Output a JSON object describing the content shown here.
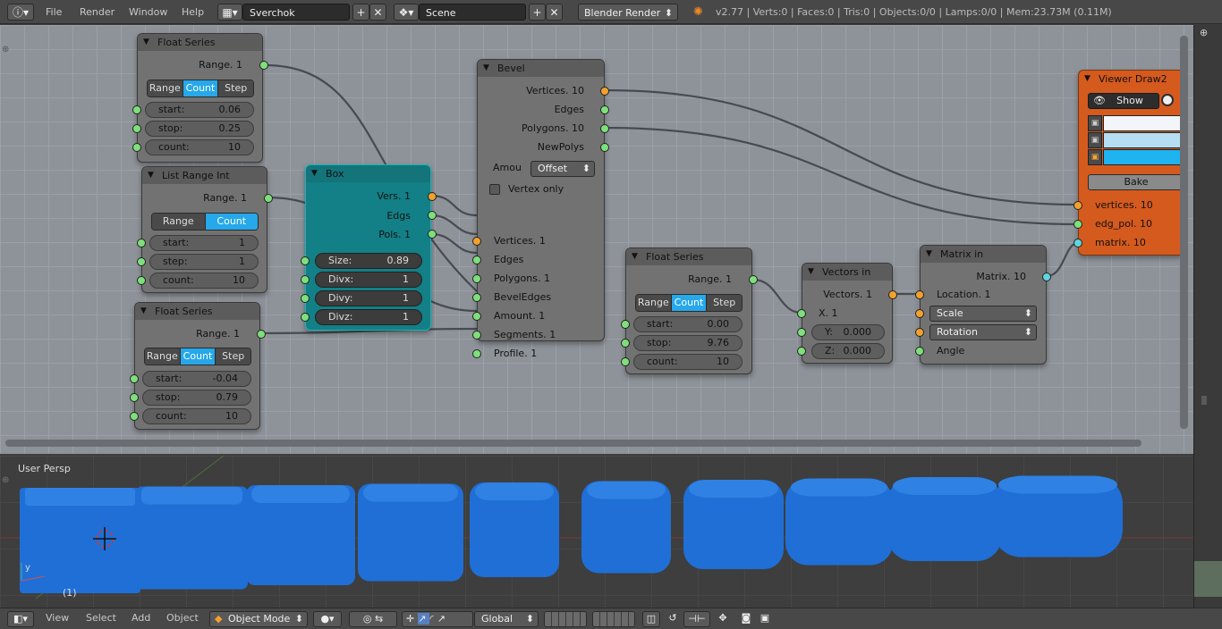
{
  "top": {
    "menus": [
      "File",
      "Render",
      "Window",
      "Help"
    ],
    "screen_layout": "Sverchok",
    "scene": "Scene",
    "render_engine": "Blender Render",
    "stats": "v2.77 | Verts:0 | Faces:0 | Tris:0 | Objects:0/0 | Lamps:0/0 | Mem:23.73M (0.11M)"
  },
  "nodes": {
    "float1": {
      "title": "Float Series",
      "out": "Range. 1",
      "modes": [
        "Range",
        "Count",
        "Step"
      ],
      "active_mode": "Count",
      "fields": [
        {
          "k": "start:",
          "v": "0.06"
        },
        {
          "k": "stop:",
          "v": "0.25"
        },
        {
          "k": "count:",
          "v": "10"
        }
      ]
    },
    "listrange": {
      "title": "List Range Int",
      "out": "Range. 1",
      "modes": [
        "Range",
        "Count"
      ],
      "active_mode": "Count",
      "fields": [
        {
          "k": "start:",
          "v": "1"
        },
        {
          "k": "step:",
          "v": "1"
        },
        {
          "k": "count:",
          "v": "10"
        }
      ]
    },
    "float2": {
      "title": "Float Series",
      "out": "Range. 1",
      "modes": [
        "Range",
        "Count",
        "Step"
      ],
      "active_mode": "Count",
      "fields": [
        {
          "k": "start:",
          "v": "-0.04"
        },
        {
          "k": "stop:",
          "v": "0.79"
        },
        {
          "k": "count:",
          "v": "10"
        }
      ]
    },
    "box": {
      "title": "Box",
      "outs": [
        "Vers. 1",
        "Edgs",
        "Pols. 1"
      ],
      "fields": [
        {
          "k": "Size:",
          "v": "0.89"
        },
        {
          "k": "Divx:",
          "v": "1"
        },
        {
          "k": "Divy:",
          "v": "1"
        },
        {
          "k": "Divz:",
          "v": "1"
        }
      ]
    },
    "bevel": {
      "title": "Bevel",
      "outs": [
        "Vertices. 10",
        "Edges",
        "Polygons. 10",
        "NewPolys"
      ],
      "amount_label": "Amou",
      "amount_mode": "Offset",
      "vertex_only": "Vertex only",
      "ins": [
        "Vertices. 1",
        "Edges",
        "Polygons. 1",
        "BevelEdges",
        "Amount. 1",
        "Segments. 1",
        "Profile. 1"
      ]
    },
    "float3": {
      "title": "Float Series",
      "out": "Range. 1",
      "modes": [
        "Range",
        "Count",
        "Step"
      ],
      "active_mode": "Count",
      "fields": [
        {
          "k": "start:",
          "v": "0.00"
        },
        {
          "k": "stop:",
          "v": "9.76"
        },
        {
          "k": "count:",
          "v": "10"
        }
      ]
    },
    "vectors": {
      "title": "Vectors in",
      "out": "Vectors. 1",
      "x": "X. 1",
      "y_label": "Y:",
      "y": "0.000",
      "z_label": "Z:",
      "z": "0.000"
    },
    "matrix": {
      "title": "Matrix in",
      "out": "Matrix. 10",
      "location": "Location. 1",
      "scale": "Scale",
      "rotation": "Rotation",
      "angle": "Angle"
    },
    "viewer": {
      "title": "Viewer Draw2",
      "show": "Show",
      "bake": "Bake",
      "ins": [
        "vertices. 10",
        "edg_pol. 10",
        "matrix. 10"
      ],
      "swatches": [
        "#f2f6fa",
        "#b5def2",
        "#1fb3ef"
      ]
    }
  },
  "viewport": {
    "label": "User Persp",
    "frame": "(1)",
    "cube_color": "#1f6fd6"
  },
  "bottom": {
    "menus": [
      "View",
      "Select",
      "Add",
      "Object"
    ],
    "mode": "Object Mode",
    "orientation": "Global"
  }
}
